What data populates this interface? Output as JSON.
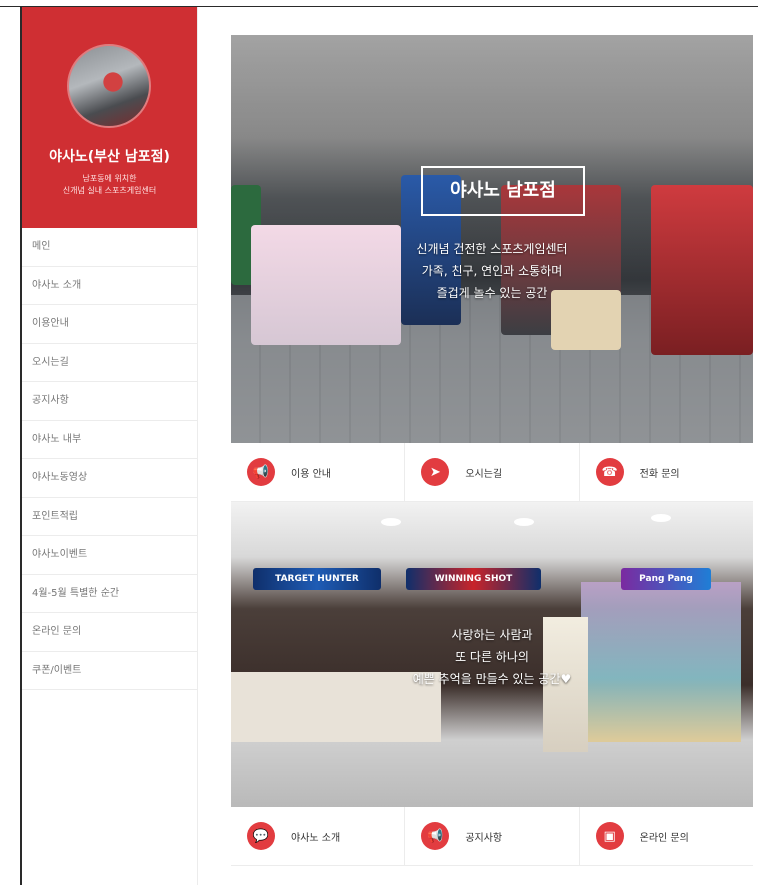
{
  "profile": {
    "store_name": "야사노(부산 남포점)",
    "desc_line1": "남포동에 위치한",
    "desc_line2": "신개념 실내 스포츠게임센터"
  },
  "menu": [
    "메인",
    "야사노 소개",
    "이용안내",
    "오시는길",
    "공지사항",
    "야사노 내부",
    "야사노동영상",
    "포인트적립",
    "야사노이벤트",
    "4월-5월 특별한 순간",
    "온라인 문의",
    "쿠폰/이벤트"
  ],
  "banner1": {
    "title": "야사노 남포점",
    "line1": "신개념 건전한 스포츠게임센터",
    "line2": "가족, 친구, 연인과 소통하며",
    "line3": "즐겁게 놀수 있는 공간"
  },
  "quick_links_1": [
    {
      "label": "이용 안내",
      "icon": "megaphone-icon"
    },
    {
      "label": "오시는길",
      "icon": "compass-icon"
    },
    {
      "label": "전화 문의",
      "icon": "phone-icon"
    }
  ],
  "banner2": {
    "sign1": "TARGET HUNTER",
    "sign2": "WINNING SHOT",
    "sign3": "Pang Pang",
    "line1": "사랑하는 사람과",
    "line2": "또 다른 하나의",
    "line3": "예쁜 추억을 만들수 있는 공간♥"
  },
  "quick_links_2": [
    {
      "label": "야사노 소개",
      "icon": "chat-icon"
    },
    {
      "label": "공지사항",
      "icon": "megaphone-icon"
    },
    {
      "label": "온라인 문의",
      "icon": "monitor-icon"
    }
  ],
  "colors": {
    "accent": "#cf2f33",
    "icon_bg": "#e23c40"
  }
}
